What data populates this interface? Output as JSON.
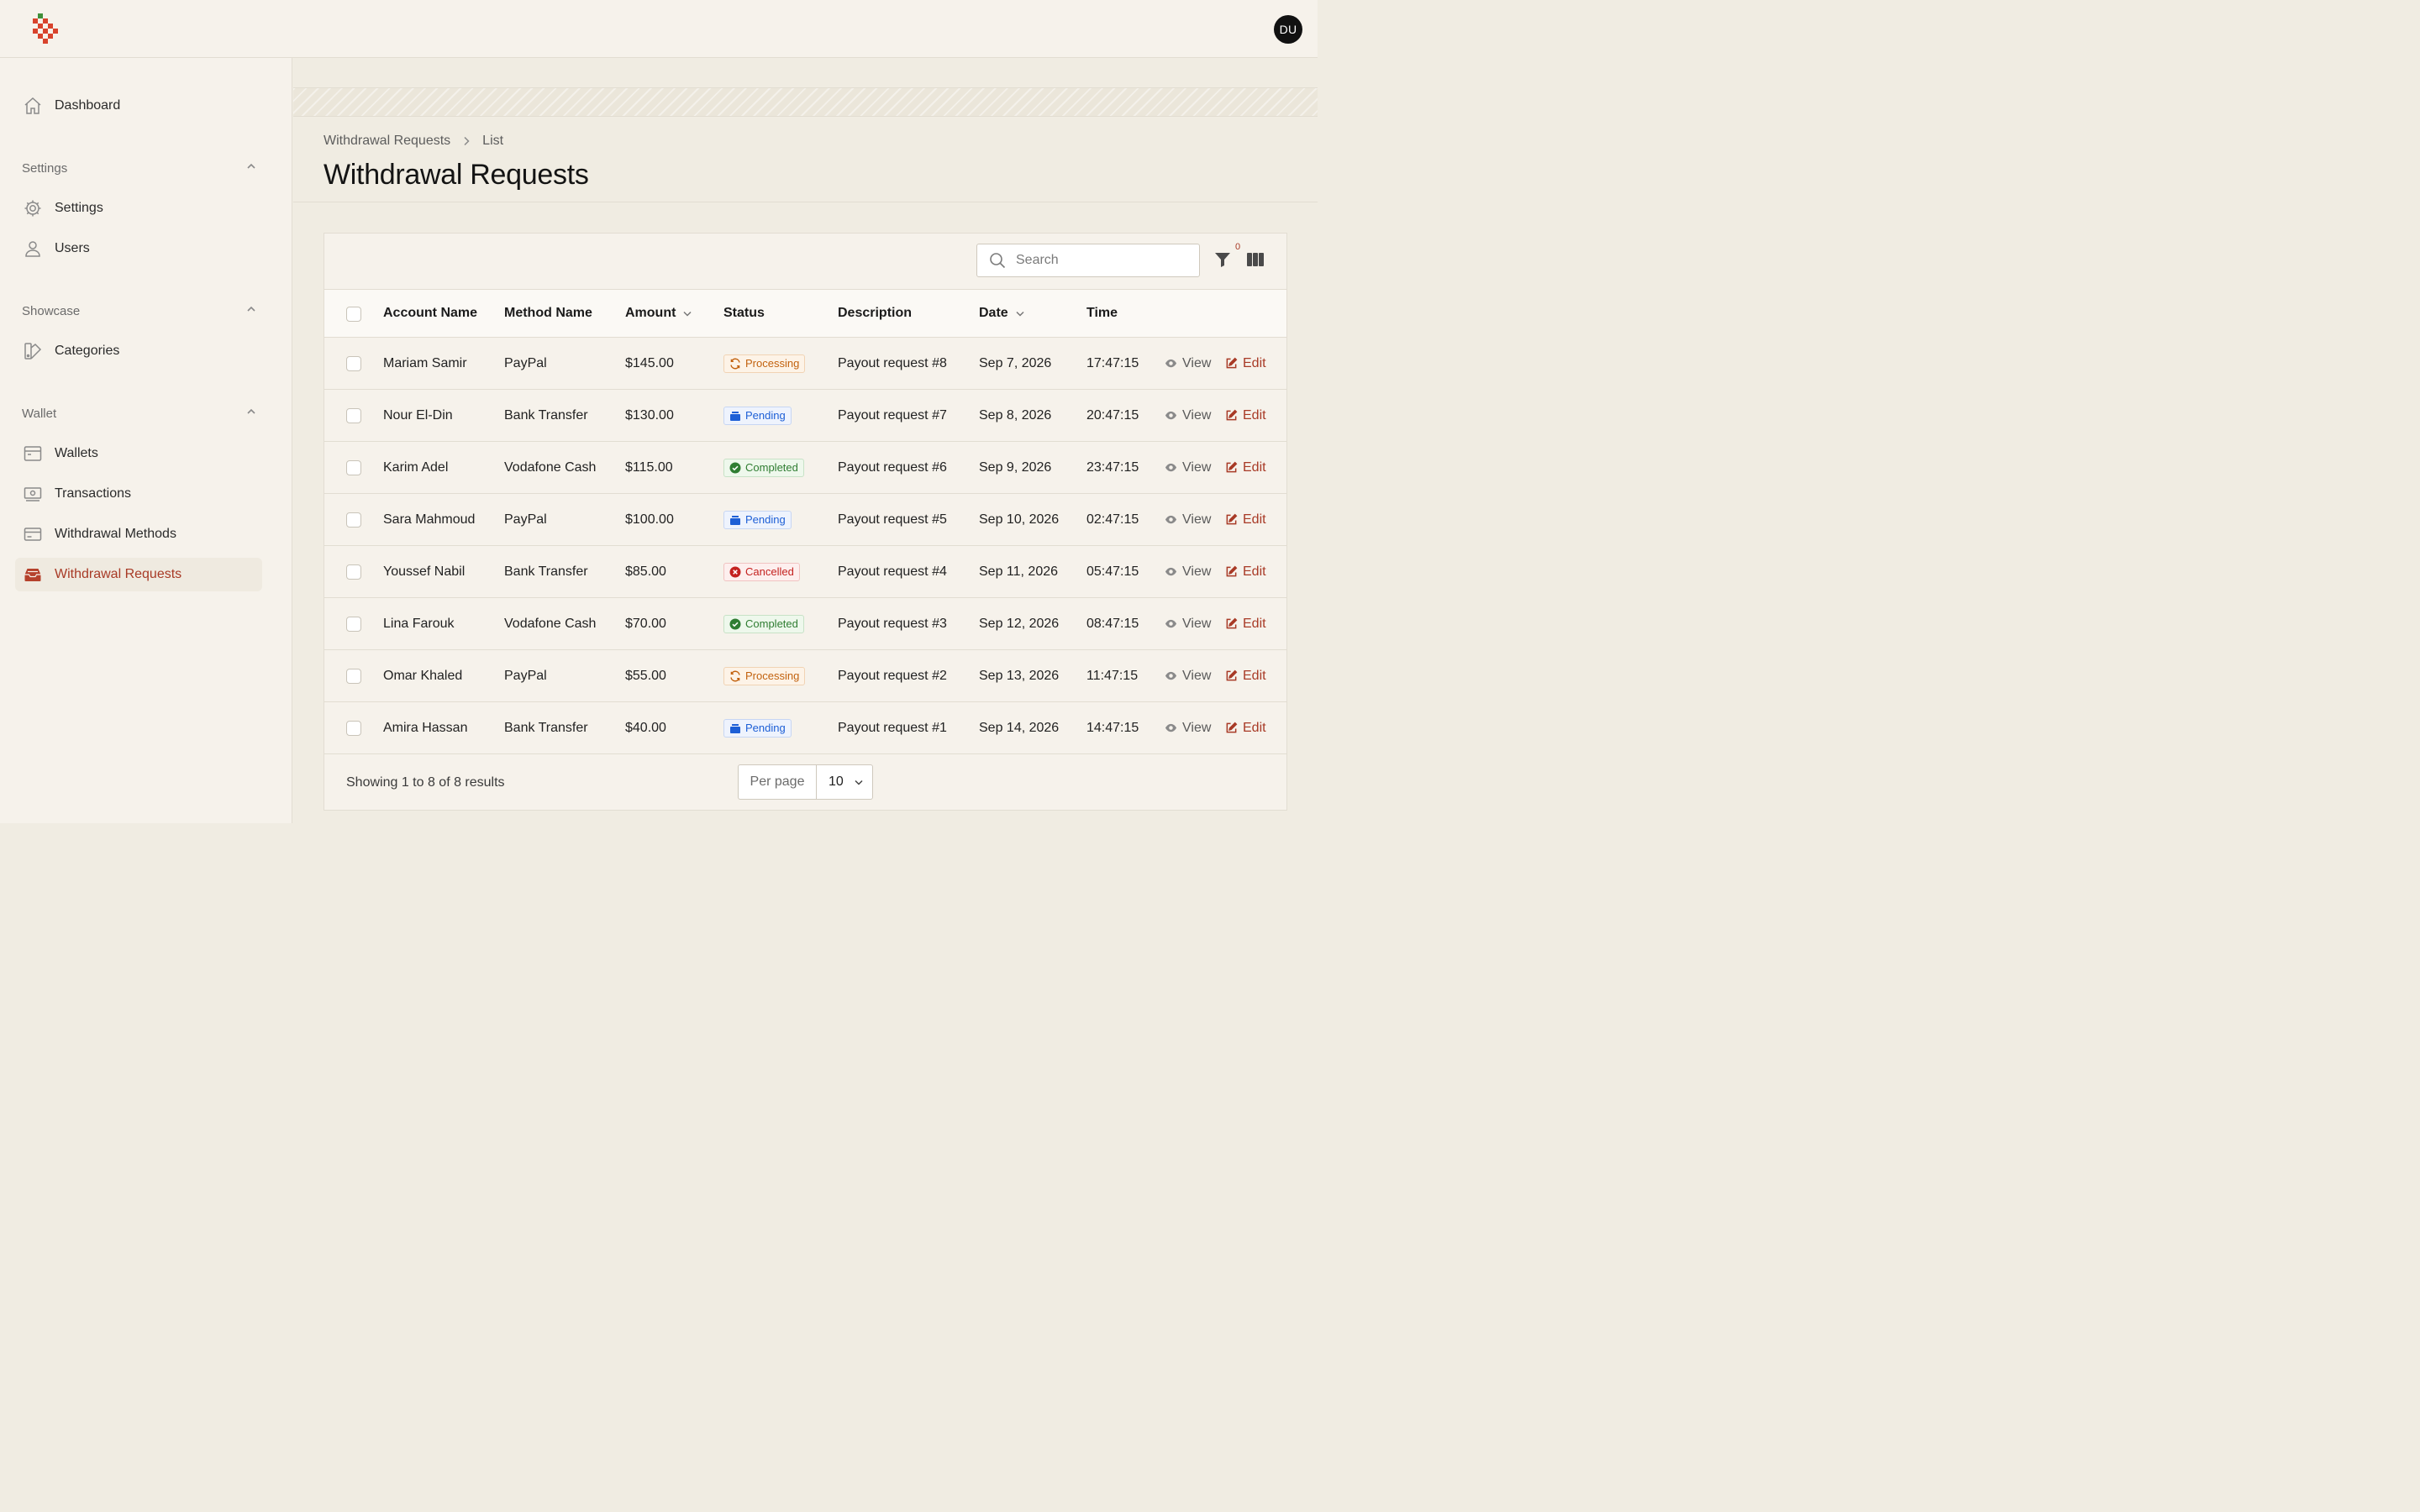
{
  "user": {
    "initials": "DU"
  },
  "sidebar": {
    "dashboard": "Dashboard",
    "groups": [
      {
        "label": "Settings",
        "items": [
          "Settings",
          "Users"
        ]
      },
      {
        "label": "Showcase",
        "items": [
          "Categories"
        ]
      },
      {
        "label": "Wallet",
        "items": [
          "Wallets",
          "Transactions",
          "Withdrawal Methods",
          "Withdrawal Requests"
        ]
      }
    ],
    "active": "Withdrawal Requests"
  },
  "breadcrumb": {
    "parent": "Withdrawal Requests",
    "current": "List"
  },
  "page": {
    "title": "Withdrawal Requests"
  },
  "toolbar": {
    "search_placeholder": "Search",
    "filter_count": "0"
  },
  "table": {
    "headers": [
      "Account Name",
      "Method Name",
      "Amount",
      "Status",
      "Description",
      "Date",
      "Time"
    ],
    "actions": {
      "view": "View",
      "edit": "Edit"
    },
    "rows": [
      {
        "account": "Mariam Samir",
        "method": "PayPal",
        "amount": "$145.00",
        "status": "Processing",
        "description": "Payout request #8",
        "date": "Sep 7, 2026",
        "time": "17:47:15"
      },
      {
        "account": "Nour El-Din",
        "method": "Bank Transfer",
        "amount": "$130.00",
        "status": "Pending",
        "description": "Payout request #7",
        "date": "Sep 8, 2026",
        "time": "20:47:15"
      },
      {
        "account": "Karim Adel",
        "method": "Vodafone Cash",
        "amount": "$115.00",
        "status": "Completed",
        "description": "Payout request #6",
        "date": "Sep 9, 2026",
        "time": "23:47:15"
      },
      {
        "account": "Sara Mahmoud",
        "method": "PayPal",
        "amount": "$100.00",
        "status": "Pending",
        "description": "Payout request #5",
        "date": "Sep 10, 2026",
        "time": "02:47:15"
      },
      {
        "account": "Youssef Nabil",
        "method": "Bank Transfer",
        "amount": "$85.00",
        "status": "Cancelled",
        "description": "Payout request #4",
        "date": "Sep 11, 2026",
        "time": "05:47:15"
      },
      {
        "account": "Lina Farouk",
        "method": "Vodafone Cash",
        "amount": "$70.00",
        "status": "Completed",
        "description": "Payout request #3",
        "date": "Sep 12, 2026",
        "time": "08:47:15"
      },
      {
        "account": "Omar Khaled",
        "method": "PayPal",
        "amount": "$55.00",
        "status": "Processing",
        "description": "Payout request #2",
        "date": "Sep 13, 2026",
        "time": "11:47:15"
      },
      {
        "account": "Amira Hassan",
        "method": "Bank Transfer",
        "amount": "$40.00",
        "status": "Pending",
        "description": "Payout request #1",
        "date": "Sep 14, 2026",
        "time": "14:47:15"
      }
    ]
  },
  "footer": {
    "summary": "Showing 1 to 8 of 8 results",
    "per_page_label": "Per page",
    "per_page_value": "10"
  },
  "colors": {
    "accent": "#a83a26",
    "processing": "#c2620f",
    "pending": "#1d5fd6",
    "completed": "#2f7d32",
    "cancelled": "#c4211f"
  }
}
